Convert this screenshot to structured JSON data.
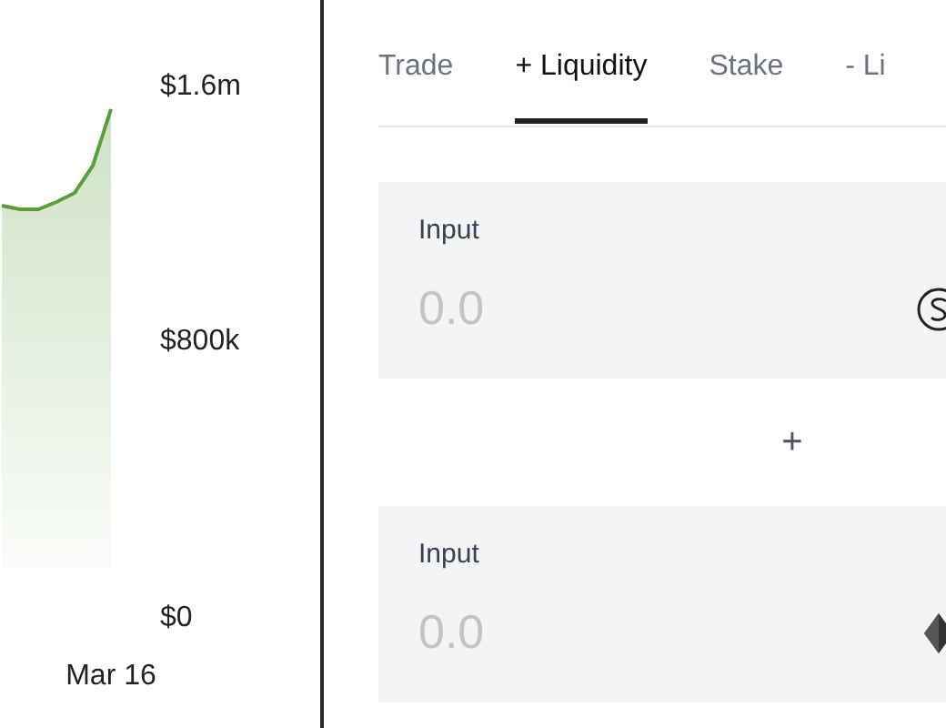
{
  "chart": {
    "y_labels": [
      "$1.6m",
      "$800k",
      "$0"
    ],
    "date_label": "Mar 16"
  },
  "tabs": [
    {
      "label": "Trade",
      "selected": false
    },
    {
      "label": "+ Liquidity",
      "selected": true
    },
    {
      "label": "Stake",
      "selected": false
    },
    {
      "label": "- Li",
      "selected": false
    }
  ],
  "inputs": [
    {
      "label": "Input",
      "placeholder": "0.0",
      "kind": "coin"
    },
    {
      "label": "Input",
      "placeholder": "0.0",
      "kind": "diamond"
    }
  ],
  "separator": "+"
}
